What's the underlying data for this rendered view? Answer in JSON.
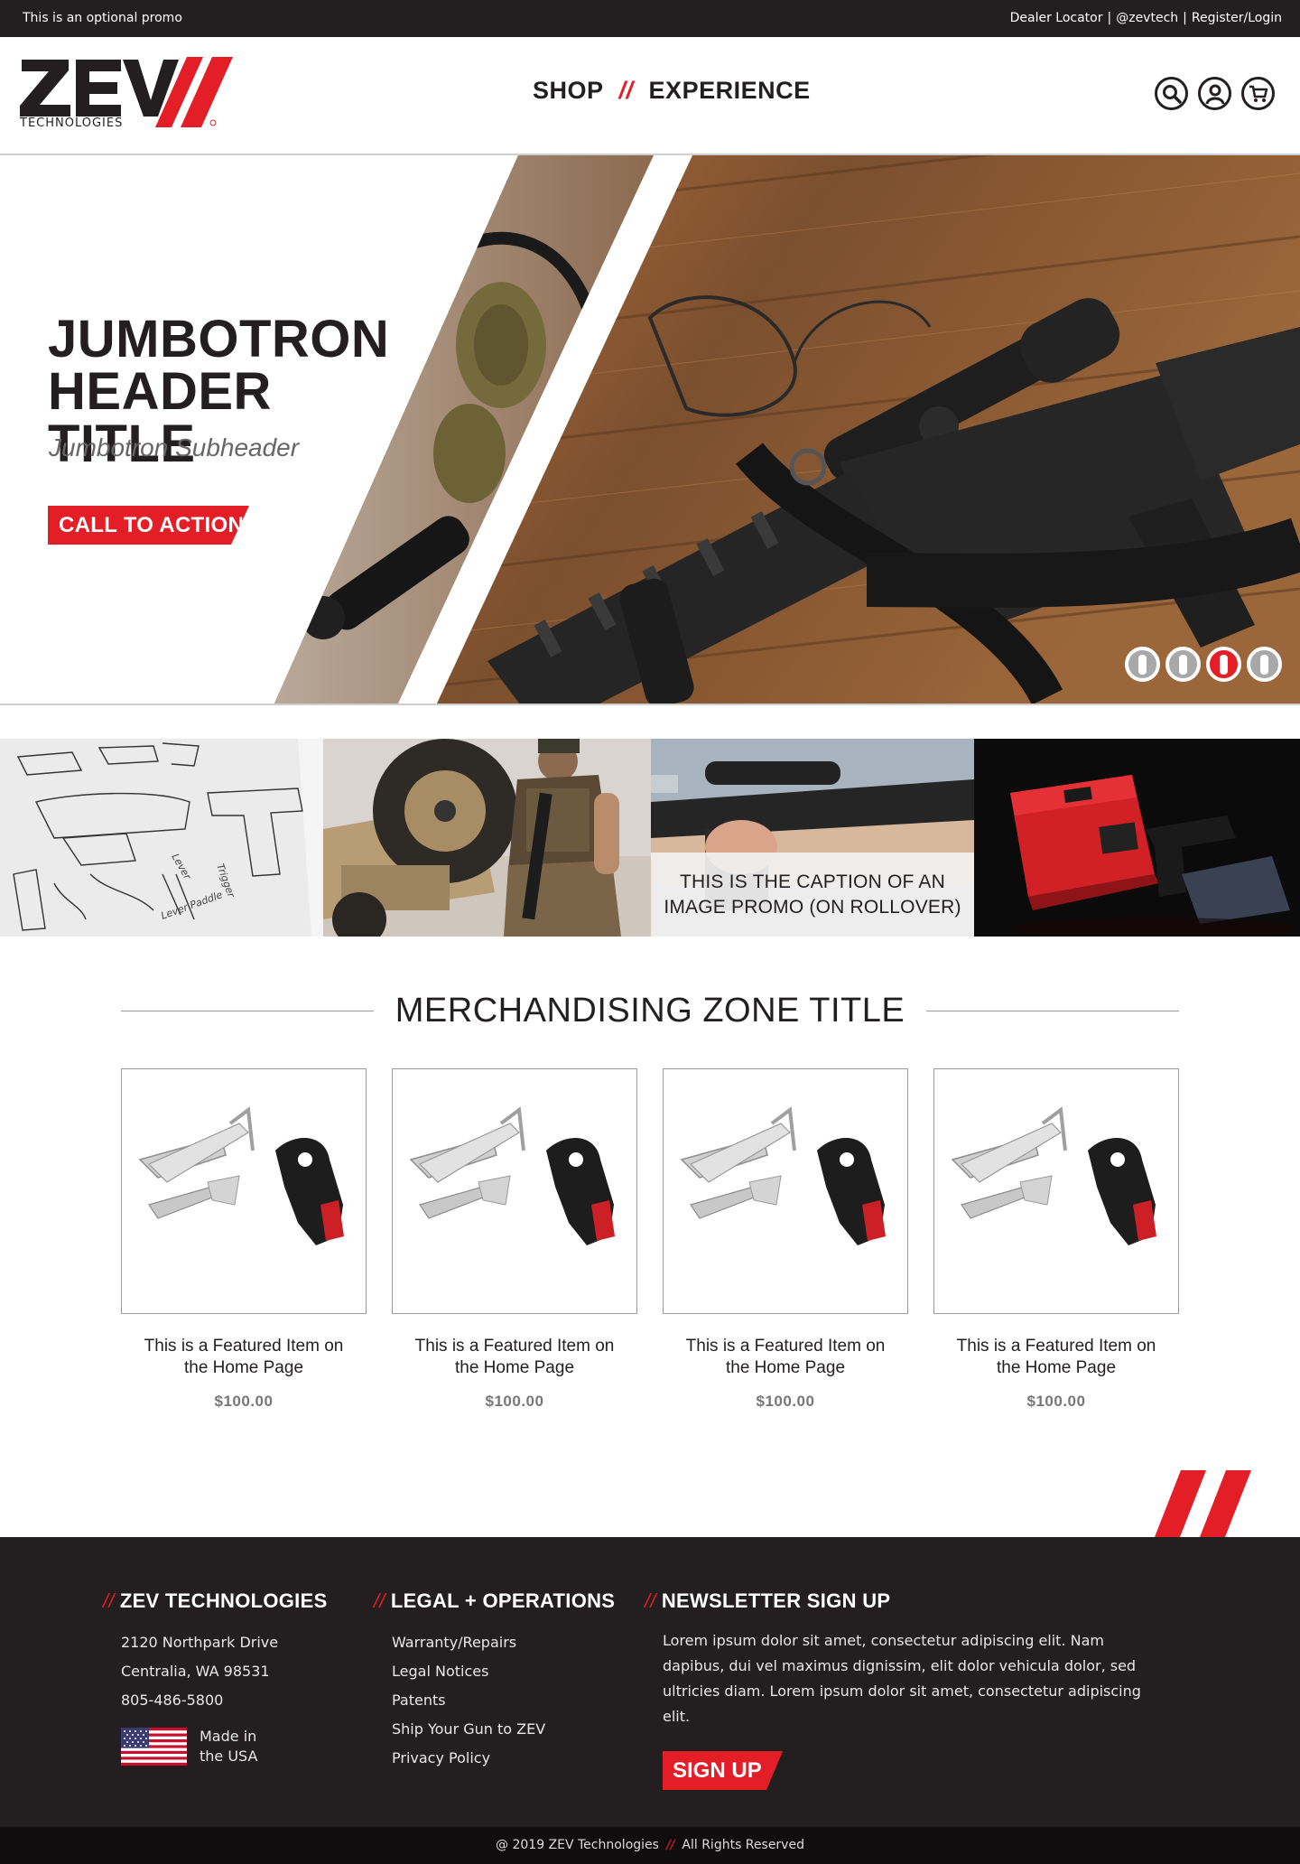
{
  "promo_bar": {
    "text": "This is an optional promo",
    "links": [
      "Dealer Locator",
      "@zevtech",
      "Register/Login"
    ],
    "separator": "|"
  },
  "header": {
    "logo": {
      "wordmark": "ZEV",
      "subtitle": "TECHNOLOGIES"
    },
    "nav": [
      {
        "label": "SHOP"
      },
      {
        "label": "EXPERIENCE"
      }
    ],
    "nav_separator": "//",
    "icons": [
      "search-icon",
      "account-icon",
      "cart-icon"
    ]
  },
  "jumbotron": {
    "title_line1": "JUMBOTRON",
    "title_line2": "HEADER TITLE",
    "subheader": "Jumbotron Subheader",
    "cta_label": "CALL TO ACTION",
    "carousel_slides": 4,
    "active_slide": 3
  },
  "promo_tiles": [
    {
      "name": "sketches"
    },
    {
      "name": "soldier-vehicle"
    },
    {
      "name": "rifle-scope",
      "caption_line1": "THIS IS THE CAPTION OF AN",
      "caption_line2": "IMAGE PROMO (ON ROLLOVER)"
    },
    {
      "name": "red-case-pistol"
    }
  ],
  "merch": {
    "title": "MERCHANDISING ZONE TITLE",
    "products": [
      {
        "name": "This is a Featured Item on the Home Page",
        "price": "$100.00"
      },
      {
        "name": "This is a Featured Item on the Home Page",
        "price": "$100.00"
      },
      {
        "name": "This is a Featured Item on the Home Page",
        "price": "$100.00"
      },
      {
        "name": "This is a Featured Item on the Home Page",
        "price": "$100.00"
      }
    ]
  },
  "footer": {
    "slashes": "//",
    "company": {
      "heading": "ZEV TECHNOLOGIES",
      "address1": "2120 Northpark Drive",
      "address2": "Centralia, WA 98531",
      "phone": "805-486-5800",
      "made_line1": "Made in",
      "made_line2": "the USA"
    },
    "legal": {
      "heading": "LEGAL + OPERATIONS",
      "links": [
        "Warranty/Repairs",
        "Legal Notices",
        "Patents",
        "Ship Your Gun to ZEV",
        "Privacy Policy"
      ]
    },
    "newsletter": {
      "heading": "NEWSLETTER SIGN UP",
      "text": "Lorem ipsum dolor sit amet, consectetur adipiscing elit. Nam dapibus, dui vel maximus dignissim, elit dolor vehicula dolor, sed ultricies diam. Lorem ipsum dolor sit amet, consectetur adipiscing elit.",
      "button": "SIGN UP"
    },
    "copyright_left": "@ 2019 ZEV Technologies",
    "copyright_right": "All Rights Reserved"
  },
  "colors": {
    "brand_red": "#e31e26",
    "dark": "#231f20",
    "gray_text": "#777777"
  }
}
